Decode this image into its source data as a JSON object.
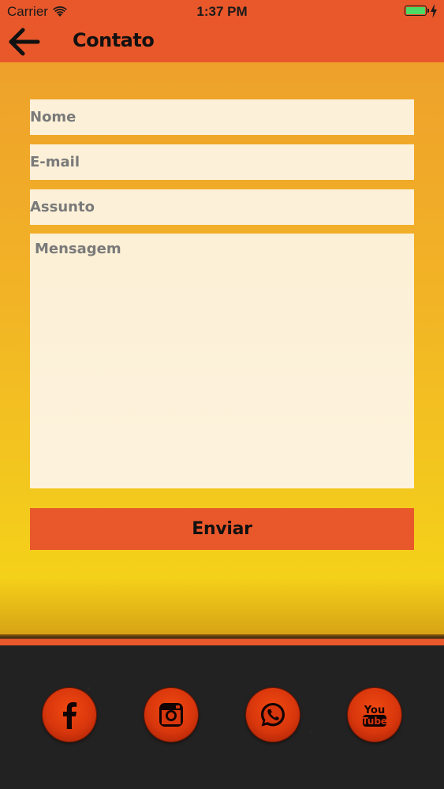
{
  "status_bar": {
    "carrier": "Carrier",
    "time": "1:37 PM",
    "battery_color": "#4cd964"
  },
  "nav": {
    "back_icon": "arrow-left-icon",
    "title": "Contato"
  },
  "form": {
    "name_placeholder": "Nome",
    "email_placeholder": "E-mail",
    "subject_placeholder": "Assunto",
    "message_placeholder": "Mensagem",
    "submit_label": "Enviar"
  },
  "social": [
    {
      "network": "facebook",
      "icon": "facebook-icon"
    },
    {
      "network": "instagram",
      "icon": "instagram-icon"
    },
    {
      "network": "whatsapp",
      "icon": "whatsapp-icon"
    },
    {
      "network": "youtube",
      "icon": "youtube-icon",
      "label_line1": "You",
      "label_line2": "Tube"
    }
  ],
  "colors": {
    "header": "#e8582b",
    "button": "#e8582b",
    "field_bg": "#fcf1d8",
    "footer": "#232222",
    "social_red": "#e03c0e"
  }
}
